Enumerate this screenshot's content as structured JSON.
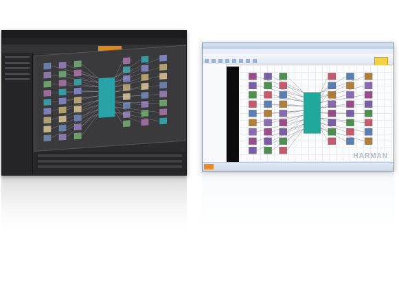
{
  "scene": {
    "brand_watermark": "HARMAN"
  },
  "dark_window": {
    "theme_colors": {
      "background": "#2b2b2d",
      "accent": "#e08a1e"
    },
    "blocks": [
      {
        "c": "#6b7fa6"
      },
      {
        "c": "#8a78a8"
      },
      {
        "c": "#6d9c6d"
      },
      {
        "c": "#9a6e9a"
      },
      {
        "c": "#3b9aa0"
      },
      {
        "c": "#7f7fb8"
      },
      {
        "c": "#b0a070"
      },
      {
        "c": "#c2b28a"
      }
    ]
  },
  "light_window": {
    "theme_colors": {
      "background": "#ffffff",
      "accent": "#f3d24a",
      "status_accent": "#e88a2a"
    }
  }
}
